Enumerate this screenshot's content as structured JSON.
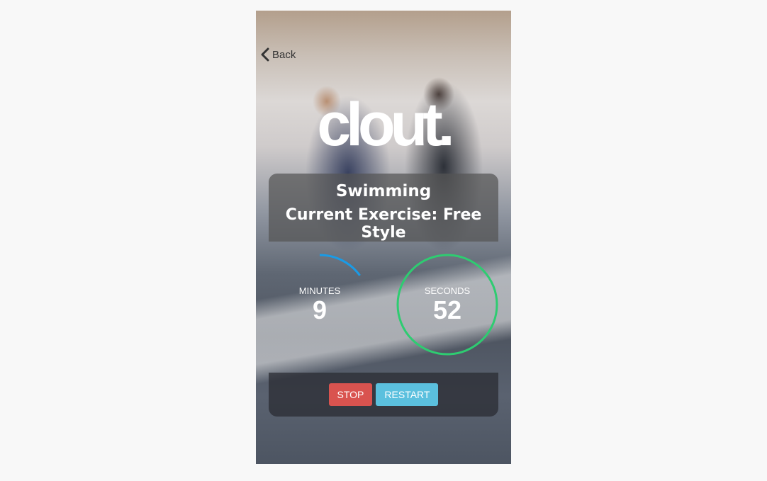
{
  "nav": {
    "back_label": "Back",
    "back_icon": "chevron-left-icon"
  },
  "brand": {
    "logo_text": "clout."
  },
  "workout": {
    "sport": "Swimming",
    "current_exercise": "Current Exercise: Free Style"
  },
  "timers": {
    "minutes": {
      "label": "MINUTES",
      "value": "9",
      "progress": 0.15,
      "color": "#1a9be6"
    },
    "seconds": {
      "label": "SECONDS",
      "value": "52",
      "progress": 1.0,
      "color": "#2ecc71"
    }
  },
  "controls": {
    "stop_label": "STOP",
    "restart_label": "RESTART",
    "stop_color": "#d9534f",
    "restart_color": "#5bc0de"
  }
}
